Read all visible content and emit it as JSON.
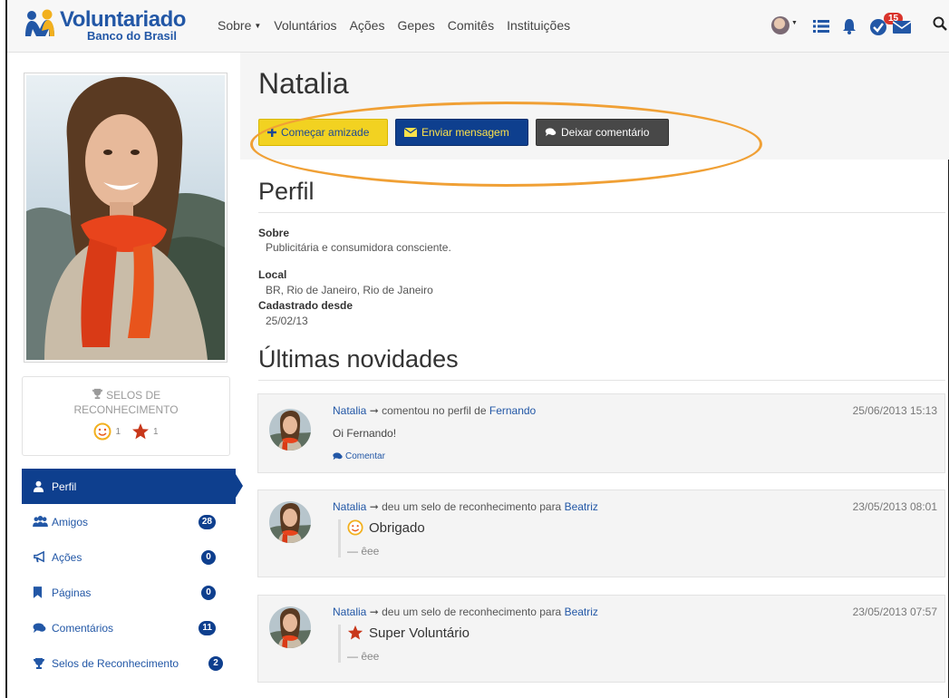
{
  "brand": {
    "title": "Voluntariado",
    "subtitle": "Banco do Brasil"
  },
  "nav": {
    "items": [
      "Sobre",
      "Voluntários",
      "Ações",
      "Gepes",
      "Comitês",
      "Instituições"
    ],
    "notifications_count": "15"
  },
  "colors": {
    "primary": "#0e3f8e",
    "link": "#2257a6",
    "accent_yellow": "#f2d221",
    "highlight": "#f0a035"
  },
  "profile": {
    "name": "Natalia",
    "buttons": {
      "friend": "Começar amizade",
      "message": "Enviar mensagem",
      "comment": "Deixar comentário"
    }
  },
  "selos": {
    "title_line1": "SELOS DE",
    "title_line2": "RECONHECIMENTO",
    "smile_count": "1",
    "star_count": "1"
  },
  "sidebar": {
    "items": [
      {
        "label": "Perfil",
        "icon": "user-icon",
        "count": null
      },
      {
        "label": "Amigos",
        "icon": "group-icon",
        "count": "28"
      },
      {
        "label": "Ações",
        "icon": "megaphone-icon",
        "count": "0"
      },
      {
        "label": "Páginas",
        "icon": "bookmark-icon",
        "count": "0"
      },
      {
        "label": "Comentários",
        "icon": "comments-icon",
        "count": "11"
      },
      {
        "label": "Selos de Reconhecimento",
        "icon": "trophy-icon",
        "count": "2"
      }
    ]
  },
  "perfil": {
    "heading": "Perfil",
    "sobre_label": "Sobre",
    "sobre_value": "Publicitária e consumidora consciente.",
    "local_label": "Local",
    "local_value": "BR, Rio de Janeiro, Rio de Janeiro",
    "since_label": "Cadastrado desde",
    "since_value": "25/02/13"
  },
  "feed": {
    "heading": "Últimas novidades",
    "items": [
      {
        "actor": "Natalia",
        "verb": "comentou no perfil de",
        "target": "Fernando",
        "date": "25/06/2013 15:13",
        "message": "Oi Fernando!",
        "action": "Comentar"
      },
      {
        "actor": "Natalia",
        "verb": "deu um selo de reconhecimento para",
        "target": "Beatriz",
        "date": "23/05/2013 08:01",
        "badge": "Obrigado",
        "author": "— êee"
      },
      {
        "actor": "Natalia",
        "verb": "deu um selo de reconhecimento para",
        "target": "Beatriz",
        "date": "23/05/2013 07:57",
        "badge": "Super Voluntário",
        "author": "— êee"
      }
    ]
  }
}
